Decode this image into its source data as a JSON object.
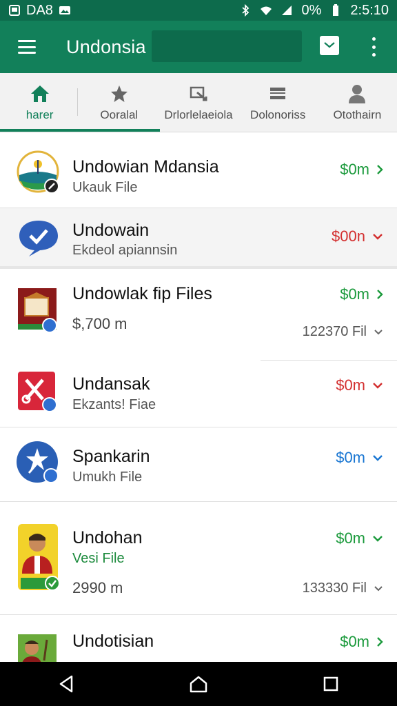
{
  "status_bar": {
    "left_text": "DA8",
    "battery": "0%",
    "time": "2:5:10"
  },
  "app_bar": {
    "title": "Undonsia",
    "search_placeholder": ""
  },
  "tabs": [
    {
      "label": "harer",
      "icon": "home-icon",
      "active": true
    },
    {
      "label": "Ooralal",
      "icon": "star-icon",
      "active": false
    },
    {
      "label": "Drlorlelaeiola",
      "icon": "share-icon",
      "active": false
    },
    {
      "label": "Dolonoriss",
      "icon": "list-icon",
      "active": false
    },
    {
      "label": "Otothairn",
      "icon": "person-icon",
      "active": false
    }
  ],
  "list": [
    {
      "title": "Undowian Mdansia",
      "sub": "Ukauk File",
      "amount": "$0m",
      "amount_color": "green",
      "chevron": "right"
    },
    {
      "title": "Undowain",
      "sub": "Ekdeol apiannsin",
      "amount": "$00n",
      "amount_color": "red",
      "chevron": "down"
    },
    {
      "title": "Undowlak fip Files",
      "meta": "$,700 m",
      "amount": "$0m",
      "amount_color": "green",
      "chevron": "right",
      "count": "122370 Fil"
    },
    {
      "title": "Undansak",
      "sub": "Ekzants! Fiae",
      "amount": "$0m",
      "amount_color": "red",
      "chevron": "down"
    },
    {
      "title": "Spankarin",
      "sub": "Umukh File",
      "amount": "$0m",
      "amount_color": "blue",
      "chevron": "down"
    },
    {
      "title": "Undohan",
      "sub": "Vesi File",
      "meta": "2990 m",
      "amount": "$0m",
      "amount_color": "green",
      "chevron": "down",
      "count": "133330 Fil"
    },
    {
      "title": "Undotisian",
      "amount": "$0m",
      "amount_color": "green",
      "chevron": "right"
    }
  ],
  "colors": {
    "primary": "#12805a",
    "primary_dark": "#0d6b4c",
    "green": "#1b9a3c",
    "red": "#d32f2f",
    "blue": "#1976d2"
  }
}
